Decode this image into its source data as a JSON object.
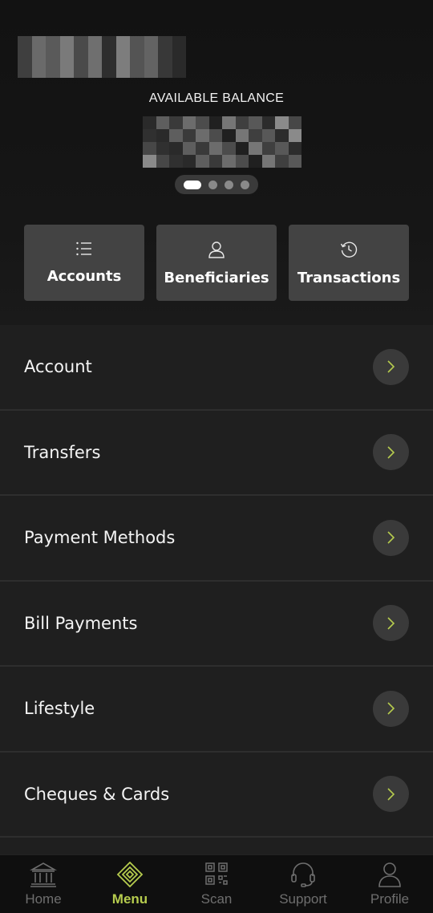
{
  "balance": {
    "label": "AVAILABLE BALANCE"
  },
  "carousel": {
    "pages": 4,
    "active_index": 0
  },
  "quick_actions": [
    {
      "label": "Accounts",
      "icon": "list-icon"
    },
    {
      "label": "Beneficiaries",
      "icon": "person-icon"
    },
    {
      "label": "Transactions",
      "icon": "history-icon"
    }
  ],
  "menu": [
    {
      "label": "Account"
    },
    {
      "label": "Transfers"
    },
    {
      "label": "Payment Methods"
    },
    {
      "label": "Bill Payments"
    },
    {
      "label": "Lifestyle"
    },
    {
      "label": "Cheques & Cards"
    }
  ],
  "bottom_nav": [
    {
      "label": "Home",
      "icon": "bank-icon",
      "active": false
    },
    {
      "label": "Menu",
      "icon": "menu-diamond-icon",
      "active": true
    },
    {
      "label": "Scan",
      "icon": "qr-code-icon",
      "active": false
    },
    {
      "label": "Support",
      "icon": "headset-icon",
      "active": false
    },
    {
      "label": "Profile",
      "icon": "user-icon",
      "active": false
    }
  ],
  "colors": {
    "accent": "#b6cc4e",
    "background": "#1f1f1f",
    "tile": "#434343"
  }
}
